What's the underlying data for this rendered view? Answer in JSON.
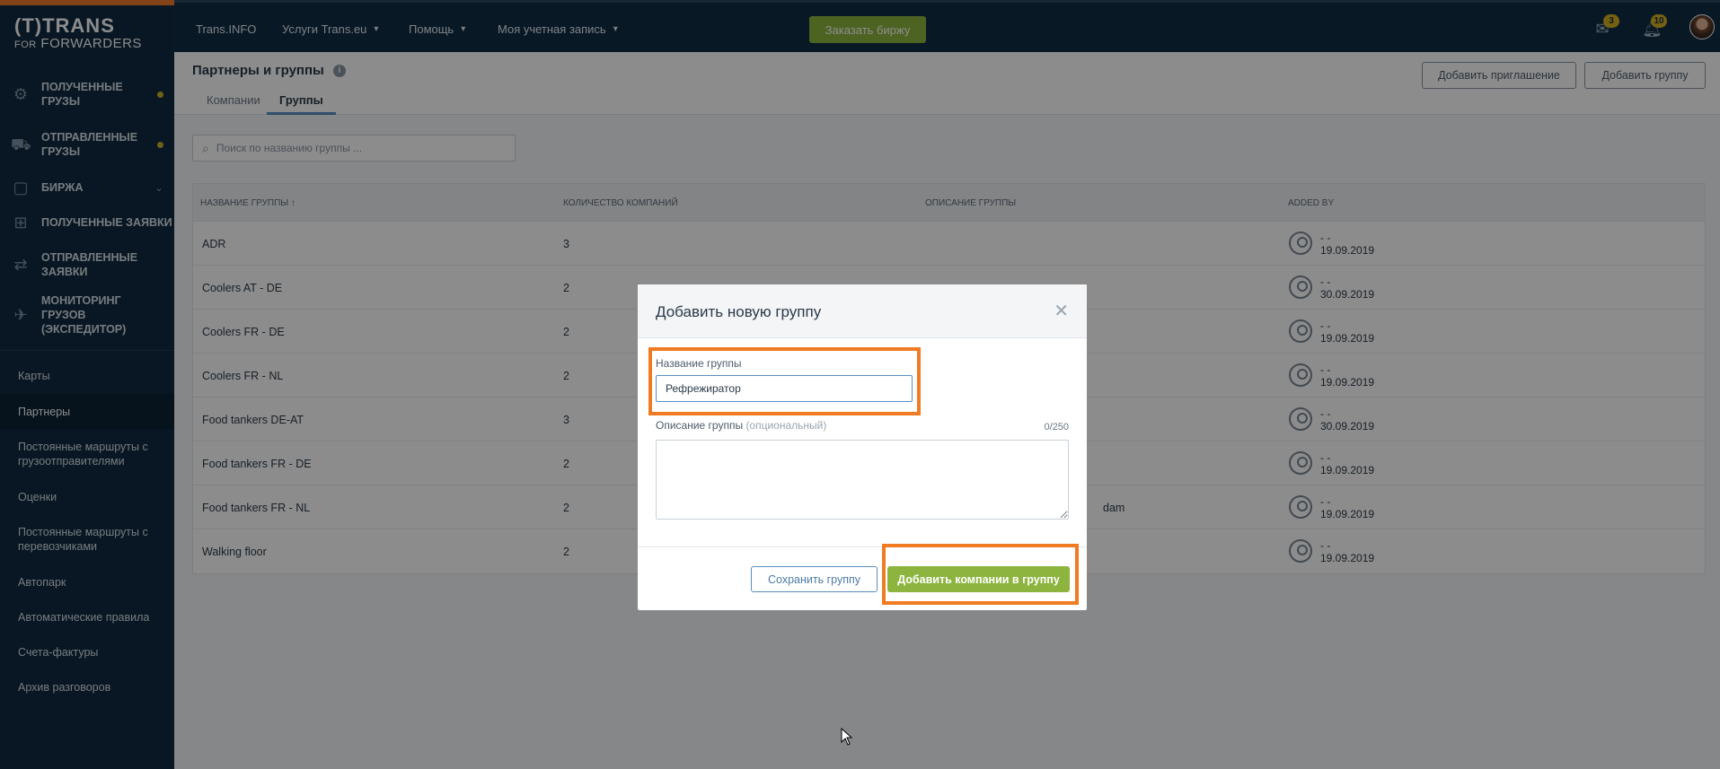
{
  "sidebar": {
    "logo_line1": "(T)TRANS",
    "logo_line2_small": "FOR",
    "logo_line2": "FORWARDERS",
    "main_items": [
      {
        "label": "ПОЛУЧЕННЫЕ ГРУЗЫ",
        "icon": "cargo-received-icon",
        "indicator": "dot"
      },
      {
        "label": "ОТПРАВЛЕННЫЕ ГРУЗЫ",
        "icon": "cargo-sent-icon",
        "indicator": "dot"
      },
      {
        "label": "БИРЖА",
        "icon": "exchange-icon",
        "indicator": "chevron"
      },
      {
        "label": "ПОЛУЧЕННЫЕ ЗАЯВКИ",
        "icon": "requests-received-icon"
      },
      {
        "label": "ОТПРАВЛЕННЫЕ ЗАЯВКИ",
        "icon": "requests-sent-icon"
      },
      {
        "label": "МОНИТОРИНГ ГРУЗОВ (ЭКСПЕДИТОР)",
        "icon": "satellite-icon"
      }
    ],
    "sub_items": [
      {
        "label": "Карты"
      },
      {
        "label": "Партнеры",
        "active": true
      },
      {
        "label": "Постоянные маршруты с грузоотправителями"
      },
      {
        "label": "Оценки"
      },
      {
        "label": "Постоянные маршруты с перевозчиками"
      },
      {
        "label": "Автопарк"
      },
      {
        "label": "Автоматические правила"
      },
      {
        "label": "Счета-фактуры"
      },
      {
        "label": "Архив разговоров"
      }
    ]
  },
  "topbar": {
    "nav": [
      {
        "label": "Trans.INFO"
      },
      {
        "label": "Услуги Trans.eu",
        "dropdown": true
      },
      {
        "label": "Помощь",
        "dropdown": true
      },
      {
        "label": "Моя учетная запись",
        "dropdown": true
      }
    ],
    "order_button": "Заказать биржу",
    "messages_badge": "3",
    "notifications_badge": "10"
  },
  "page": {
    "title": "Партнеры и группы",
    "tabs": [
      {
        "label": "Компании"
      },
      {
        "label": "Группы",
        "active": true
      }
    ],
    "add_invitation_button": "Добавить приглашение",
    "add_group_button": "Добавить группу",
    "search_placeholder": "Поиск по названию группы ..."
  },
  "table": {
    "headers": {
      "name": "НАЗВАНИЕ ГРУППЫ ↑",
      "count": "КОЛИЧЕСТВО КОМПАНИЙ",
      "description": "ОПИСАНИЕ ГРУППЫ",
      "added_by": "ADDED BY"
    },
    "rows": [
      {
        "name": "ADR",
        "count": "3",
        "description": "",
        "added_name": "- -",
        "added_date": "19.09.2019"
      },
      {
        "name": "Coolers AT - DE",
        "count": "2",
        "description": "",
        "added_name": "- -",
        "added_date": "30.09.2019"
      },
      {
        "name": "Coolers FR - DE",
        "count": "2",
        "description": "",
        "added_name": "- -",
        "added_date": "19.09.2019"
      },
      {
        "name": "Coolers FR - NL",
        "count": "2",
        "description": "",
        "added_name": "- -",
        "added_date": "19.09.2019"
      },
      {
        "name": "Food tankers DE-AT",
        "count": "3",
        "description": "",
        "added_name": "- -",
        "added_date": "30.09.2019"
      },
      {
        "name": "Food tankers FR - DE",
        "count": "2",
        "description": "",
        "added_name": "- -",
        "added_date": "19.09.2019"
      },
      {
        "name": "Food tankers FR - NL",
        "count": "2",
        "description": "dam",
        "added_name": "- -",
        "added_date": "19.09.2019"
      },
      {
        "name": "Walking floor",
        "count": "2",
        "description": "",
        "added_name": "- -",
        "added_date": "19.09.2019"
      }
    ]
  },
  "modal": {
    "title": "Добавить новую группу",
    "name_label": "Название группы",
    "name_value": "Рефрежиратор",
    "description_label": "Описание группы",
    "description_optional": "(опциональный)",
    "description_counter": "0/250",
    "description_value": "",
    "save_button": "Сохранить группу",
    "add_companies_button": "Добавить компании в группу"
  },
  "colors": {
    "sidebar_bg": "#0f2a40",
    "accent_green": "#8db43e",
    "highlight_orange": "#f07b22",
    "badge_yellow": "#d6b11f"
  }
}
